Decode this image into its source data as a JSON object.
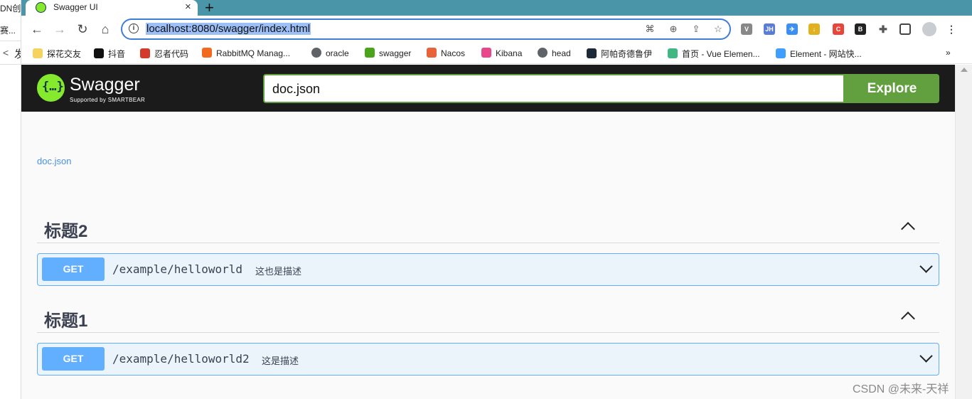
{
  "left_window": {
    "line1": "DN创作",
    "line2": "赛...",
    "back_glyph": "<",
    "char": "发"
  },
  "browser": {
    "tab": {
      "title": "Swagger UI",
      "close": "×"
    },
    "new_tab": "+",
    "address": "localhost:8080/swagger/index.html",
    "info_glyph": "i"
  },
  "bookmarks": [
    {
      "label": "探花交友",
      "color": "#f4d35e"
    },
    {
      "label": "抖音",
      "color": "#111111"
    },
    {
      "label": "忍者代码",
      "color": "#d33a2c"
    },
    {
      "label": "RabbitMQ Manag...",
      "color": "#f26b1d"
    },
    {
      "label": "oracle",
      "color": "#5f6368"
    },
    {
      "label": "swagger",
      "color": "#49a31b"
    },
    {
      "label": "Nacos",
      "color": "#e8623a"
    },
    {
      "label": "Kibana",
      "color": "#e8478b"
    },
    {
      "label": "head",
      "color": "#5f6368"
    },
    {
      "label": "阿帕奇德鲁伊",
      "color": "#1b2a36"
    },
    {
      "label": "首页 - Vue Elemen...",
      "color": "#41b883"
    },
    {
      "label": "Element - 网站快...",
      "color": "#409eff"
    }
  ],
  "bookmarks_more": "»",
  "extensions": {
    "jh": "JH",
    "c": "C",
    "b": "B"
  },
  "swagger": {
    "brand": "Swagger",
    "tagline": "Supported by SMARTBEAR",
    "url_value": "doc.json",
    "explore_label": "Explore",
    "doc_link": "doc.json",
    "sections": [
      {
        "title": "标题2",
        "operation": {
          "method": "GET",
          "path": "/example/helloworld",
          "summary": "这也是描述"
        }
      },
      {
        "title": "标题1",
        "operation": {
          "method": "GET",
          "path": "/example/helloworld2",
          "summary": "这是描述"
        }
      }
    ],
    "colors": {
      "get": "#61affe",
      "explore": "#62a03f",
      "topbar": "#1b1b1b"
    }
  },
  "watermark": "CSDN @未来-天祥"
}
